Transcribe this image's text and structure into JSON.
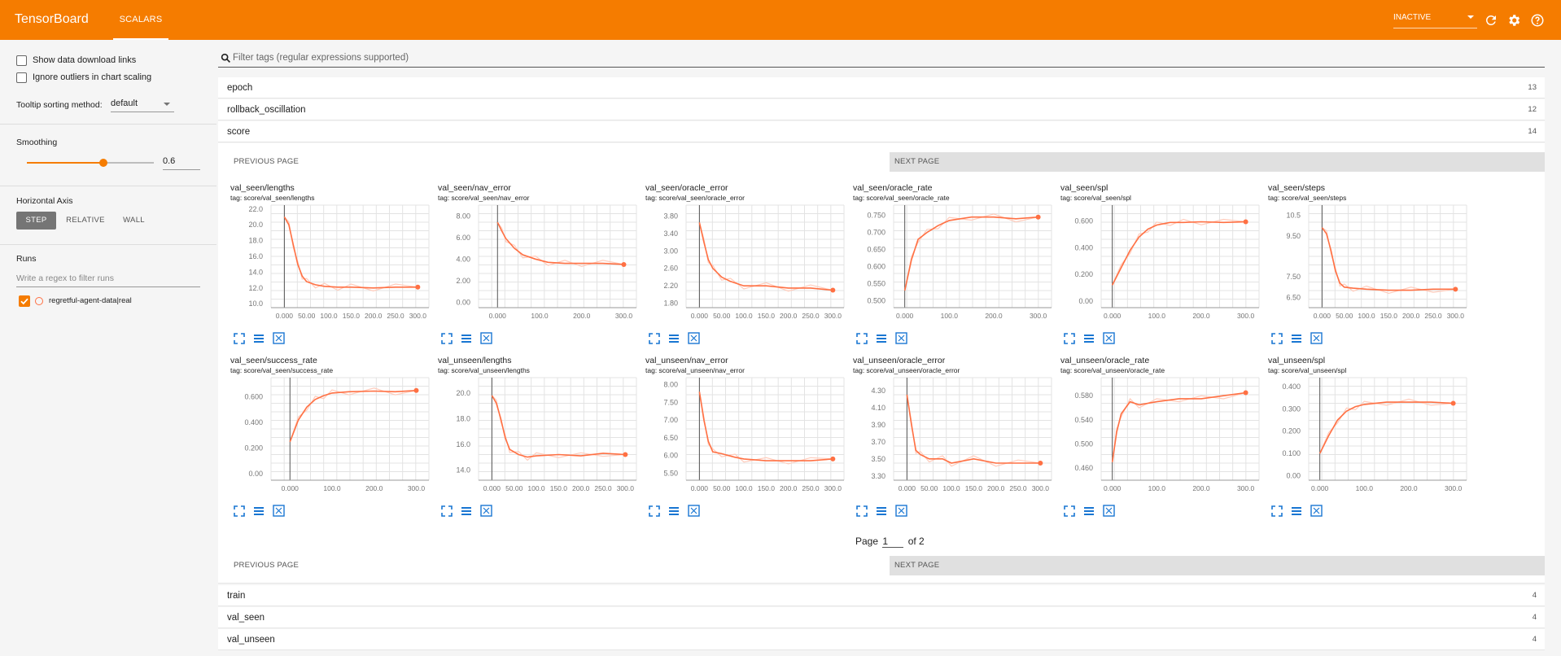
{
  "app": {
    "title": "TensorBoard",
    "nav_tab": "SCALARS",
    "status_select": "INACTIVE"
  },
  "sidebar": {
    "show_download_links": "Show data download links",
    "ignore_outliers": "Ignore outliers in chart scaling",
    "tooltip_label": "Tooltip sorting method:",
    "tooltip_value": "default",
    "smoothing_label": "Smoothing",
    "smoothing_value": "0.6",
    "smoothing_fraction": 0.6,
    "horizontal_axis_label": "Horizontal Axis",
    "axis_options": [
      "STEP",
      "RELATIVE",
      "WALL"
    ],
    "runs_label": "Runs",
    "runs_filter_placeholder": "Write a regex to filter runs",
    "run_name": "regretful-agent-data|real"
  },
  "filter": {
    "placeholder": "Filter tags (regular expressions supported)"
  },
  "categories_top": [
    {
      "name": "epoch",
      "count": "13"
    },
    {
      "name": "rollback_oscillation",
      "count": "12"
    },
    {
      "name": "score",
      "count": "14"
    }
  ],
  "categories_bottom": [
    {
      "name": "train",
      "count": "4"
    },
    {
      "name": "val_seen",
      "count": "4"
    },
    {
      "name": "val_unseen",
      "count": "4"
    }
  ],
  "pagination": {
    "prev": "PREVIOUS PAGE",
    "next": "NEXT PAGE",
    "page_prefix": "Page",
    "page_value": "1",
    "page_suffix": "of 2"
  },
  "colors": {
    "accent": "#f57c00",
    "line": "#ff7043",
    "raw": "#ffccbc",
    "icon": "#1976d2"
  },
  "chart_data": [
    {
      "type": "line",
      "title": "val_seen/lengths",
      "tag": "tag: score/val_seen/lengths",
      "yticks": [
        "22.0",
        "20.0",
        "18.0",
        "16.0",
        "14.0",
        "12.0",
        "10.0"
      ],
      "ylim": [
        9.5,
        22.5
      ],
      "xticks": [
        "0.000",
        "50.00",
        "100.0",
        "150.0",
        "200.0",
        "250.0",
        "300.0"
      ],
      "xlim": [
        -30,
        325
      ],
      "series": [
        {
          "x": [
            0,
            10,
            20,
            30,
            40,
            50,
            70,
            90,
            120,
            150,
            200,
            250,
            300
          ],
          "y": [
            21,
            20,
            17.5,
            15,
            13.5,
            12.8,
            12.4,
            12.2,
            12.1,
            12.1,
            12.0,
            12.1,
            12.1
          ]
        }
      ]
    },
    {
      "type": "line",
      "title": "val_seen/nav_error",
      "tag": "tag: score/val_seen/nav_error",
      "yticks": [
        "8.00",
        "6.00",
        "4.00",
        "2.00",
        "0.00"
      ],
      "ylim": [
        -0.5,
        9
      ],
      "xticks": [
        "0.000",
        "100.0",
        "200.0",
        "300.0"
      ],
      "xlim": [
        -45,
        330
      ],
      "series": [
        {
          "x": [
            0,
            10,
            20,
            40,
            60,
            90,
            120,
            160,
            200,
            250,
            300
          ],
          "y": [
            7.4,
            6.6,
            5.9,
            5.0,
            4.4,
            4.0,
            3.7,
            3.6,
            3.6,
            3.6,
            3.5
          ]
        }
      ]
    },
    {
      "type": "line",
      "title": "val_seen/oracle_error",
      "tag": "tag: score/val_seen/oracle_error",
      "yticks": [
        "3.80",
        "3.40",
        "3.00",
        "2.60",
        "2.20",
        "1.80"
      ],
      "ylim": [
        1.7,
        4.05
      ],
      "xticks": [
        "0.000",
        "50.00",
        "100.0",
        "150.0",
        "200.0",
        "250.0",
        "300.0"
      ],
      "xlim": [
        -30,
        325
      ],
      "series": [
        {
          "x": [
            0,
            10,
            20,
            30,
            50,
            70,
            100,
            150,
            200,
            250,
            300
          ],
          "y": [
            3.65,
            3.2,
            2.8,
            2.6,
            2.4,
            2.3,
            2.2,
            2.2,
            2.15,
            2.15,
            2.1
          ]
        }
      ]
    },
    {
      "type": "line",
      "title": "val_seen/oracle_rate",
      "tag": "tag: score/val_seen/oracle_rate",
      "yticks": [
        "0.750",
        "0.700",
        "0.650",
        "0.600",
        "0.550",
        "0.500"
      ],
      "ylim": [
        0.48,
        0.78
      ],
      "xticks": [
        "0.000",
        "100.0",
        "200.0",
        "300.0"
      ],
      "xlim": [
        -25,
        330
      ],
      "series": [
        {
          "x": [
            0,
            15,
            30,
            50,
            75,
            100,
            150,
            200,
            250,
            300
          ],
          "y": [
            0.53,
            0.62,
            0.68,
            0.7,
            0.72,
            0.735,
            0.745,
            0.745,
            0.74,
            0.745
          ]
        }
      ]
    },
    {
      "type": "line",
      "title": "val_seen/spl",
      "tag": "tag: score/val_seen/spl",
      "yticks": [
        "0.600",
        "0.400",
        "0.200",
        "0.00"
      ],
      "ylim": [
        -0.05,
        0.72
      ],
      "xticks": [
        "0.000",
        "100.0",
        "200.0",
        "300.0"
      ],
      "xlim": [
        -25,
        330
      ],
      "series": [
        {
          "x": [
            0,
            20,
            40,
            60,
            80,
            100,
            130,
            160,
            200,
            250,
            300
          ],
          "y": [
            0.12,
            0.25,
            0.38,
            0.48,
            0.54,
            0.57,
            0.59,
            0.59,
            0.595,
            0.59,
            0.595
          ]
        }
      ]
    },
    {
      "type": "line",
      "title": "val_seen/steps",
      "tag": "tag: score/val_seen/steps",
      "yticks": [
        "10.5",
        "9.50",
        "7.50",
        "6.50"
      ],
      "ylim": [
        6.0,
        11.0
      ],
      "xticks": [
        "0.000",
        "50.00",
        "100.0",
        "150.0",
        "200.0",
        "250.0",
        "300.0"
      ],
      "xlim": [
        -30,
        325
      ],
      "series": [
        {
          "x": [
            0,
            10,
            20,
            30,
            40,
            50,
            70,
            100,
            150,
            200,
            250,
            300
          ],
          "y": [
            9.9,
            9.6,
            8.8,
            7.8,
            7.2,
            7.0,
            6.95,
            6.9,
            6.85,
            6.85,
            6.9,
            6.9
          ]
        }
      ]
    },
    {
      "type": "line",
      "title": "val_seen/success_rate",
      "tag": "tag: score/val_seen/success_rate",
      "yticks": [
        "0.600",
        "0.400",
        "0.200",
        "0.00"
      ],
      "ylim": [
        -0.05,
        0.75
      ],
      "xticks": [
        "0.000",
        "100.0",
        "200.0",
        "300.0"
      ],
      "xlim": [
        -45,
        330
      ],
      "series": [
        {
          "x": [
            0,
            20,
            40,
            60,
            80,
            100,
            140,
            200,
            250,
            300
          ],
          "y": [
            0.25,
            0.42,
            0.52,
            0.58,
            0.61,
            0.63,
            0.64,
            0.645,
            0.64,
            0.65
          ]
        }
      ]
    },
    {
      "type": "line",
      "title": "val_unseen/lengths",
      "tag": "tag: score/val_unseen/lengths",
      "yticks": [
        "20.0",
        "18.0",
        "16.0",
        "14.0"
      ],
      "ylim": [
        13.2,
        21.2
      ],
      "xticks": [
        "0.000",
        "50.00",
        "100.0",
        "150.0",
        "200.0",
        "250.0",
        "300.0"
      ],
      "xlim": [
        -30,
        325
      ],
      "series": [
        {
          "x": [
            0,
            10,
            20,
            30,
            40,
            60,
            80,
            100,
            150,
            200,
            250,
            300
          ],
          "y": [
            19.8,
            19.2,
            18.0,
            16.5,
            15.6,
            15.2,
            15.0,
            15.1,
            15.2,
            15.1,
            15.3,
            15.2
          ]
        }
      ]
    },
    {
      "type": "line",
      "title": "val_unseen/nav_error",
      "tag": "tag: score/val_unseen/nav_error",
      "yticks": [
        "8.00",
        "7.50",
        "7.00",
        "6.50",
        "6.00",
        "5.50"
      ],
      "ylim": [
        5.3,
        8.2
      ],
      "xticks": [
        "0.000",
        "50.00",
        "100.0",
        "150.0",
        "200.0",
        "250.0",
        "300.0"
      ],
      "xlim": [
        -30,
        325
      ],
      "series": [
        {
          "x": [
            0,
            10,
            20,
            30,
            50,
            80,
            100,
            150,
            200,
            250,
            300
          ],
          "y": [
            7.8,
            7.0,
            6.4,
            6.1,
            6.05,
            5.95,
            5.9,
            5.85,
            5.85,
            5.85,
            5.9
          ]
        }
      ]
    },
    {
      "type": "line",
      "title": "val_unseen/oracle_error",
      "tag": "tag: score/val_unseen/oracle_error",
      "yticks": [
        "4.30",
        "4.10",
        "3.90",
        "3.70",
        "3.50",
        "3.30"
      ],
      "ylim": [
        3.25,
        4.45
      ],
      "xticks": [
        "0.000",
        "50.00",
        "100.0",
        "150.0",
        "200.0",
        "250.0",
        "300.0"
      ],
      "xlim": [
        -30,
        325
      ],
      "series": [
        {
          "x": [
            0,
            10,
            20,
            30,
            50,
            80,
            100,
            150,
            200,
            250,
            300
          ],
          "y": [
            4.25,
            3.9,
            3.6,
            3.55,
            3.5,
            3.5,
            3.45,
            3.5,
            3.45,
            3.45,
            3.45
          ]
        }
      ]
    },
    {
      "type": "line",
      "title": "val_unseen/oracle_rate",
      "tag": "tag: score/val_unseen/oracle_rate",
      "yticks": [
        "0.580",
        "0.540",
        "0.500",
        "0.460"
      ],
      "ylim": [
        0.44,
        0.61
      ],
      "xticks": [
        "0.000",
        "100.0",
        "200.0",
        "300.0"
      ],
      "xlim": [
        -25,
        330
      ],
      "series": [
        {
          "x": [
            0,
            10,
            20,
            40,
            60,
            100,
            150,
            200,
            250,
            300
          ],
          "y": [
            0.47,
            0.52,
            0.55,
            0.57,
            0.565,
            0.57,
            0.575,
            0.575,
            0.58,
            0.585
          ]
        }
      ]
    },
    {
      "type": "line",
      "title": "val_unseen/spl",
      "tag": "tag: score/val_unseen/spl",
      "yticks": [
        "0.400",
        "0.300",
        "0.200",
        "0.100",
        "0.00"
      ],
      "ylim": [
        -0.02,
        0.44
      ],
      "xticks": [
        "0.000",
        "100.0",
        "200.0",
        "300.0"
      ],
      "xlim": [
        -25,
        330
      ],
      "series": [
        {
          "x": [
            0,
            20,
            40,
            60,
            80,
            100,
            150,
            200,
            250,
            300
          ],
          "y": [
            0.1,
            0.18,
            0.25,
            0.29,
            0.31,
            0.32,
            0.33,
            0.33,
            0.33,
            0.325
          ]
        }
      ]
    }
  ]
}
